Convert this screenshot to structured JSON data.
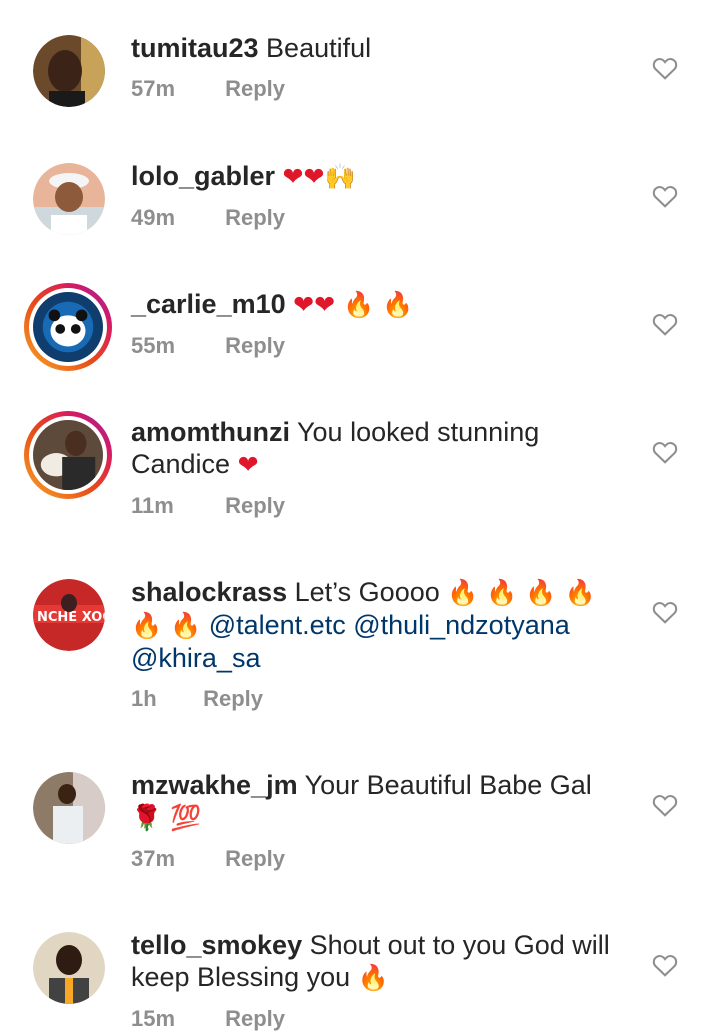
{
  "reply_label": "Reply",
  "colors": {
    "text": "#262626",
    "muted": "#8e8e8e",
    "mention": "#00376b",
    "heart": "#e0162b"
  },
  "comments": [
    {
      "username": "tumitau23",
      "text": "Beautiful",
      "emoji": "",
      "time": "57m"
    },
    {
      "username": "lolo_gabler",
      "text": "",
      "emoji": "❤❤🙌",
      "time": "49m"
    },
    {
      "username": "_carlie_m10",
      "text": "",
      "emoji": "❤❤ 🔥 🔥",
      "time": "55m"
    },
    {
      "username": "amomthunzi",
      "text": "You looked stunning Candice",
      "emoji": "❤",
      "time": "11m"
    },
    {
      "username": "shalockrass",
      "text": "Let’s Goooo",
      "emoji": "🔥 🔥 🔥 🔥 🔥 🔥",
      "mentions": "@talent.etc @thuli_ndzotyana @khira_sa",
      "time": "1h"
    },
    {
      "username": "mzwakhe_jm",
      "text": "Your Beautiful Babe Gal",
      "emoji": "🌹 💯",
      "time": "37m"
    },
    {
      "username": "tello_smokey",
      "text": "Shout out to you God will keep Blessing you",
      "emoji": "🔥",
      "time": "15m"
    }
  ]
}
